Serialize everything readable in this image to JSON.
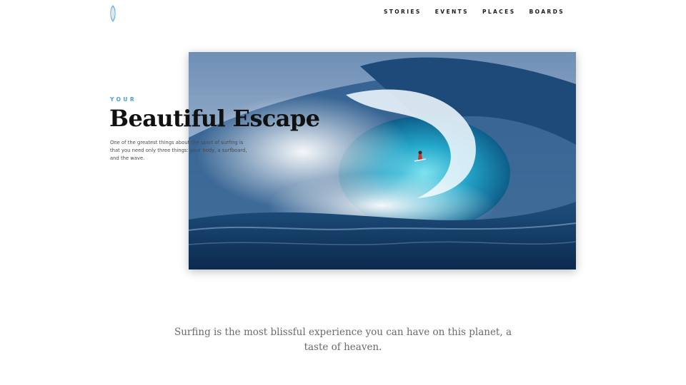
{
  "header": {
    "logo_icon": "surfboard-icon",
    "nav": [
      {
        "label": "STORIES"
      },
      {
        "label": "EVENTS"
      },
      {
        "label": "PLACES"
      },
      {
        "label": "BOARDS"
      }
    ]
  },
  "hero": {
    "eyebrow": "YOUR",
    "title": "Beautiful Escape",
    "description": "One of the greatest things about the sport of surfing is that you need only three things: your body, a surfboard, and the wave.",
    "image_icon": "surfer-wave-photo"
  },
  "quote": {
    "text": "Surfing is the most blissful experience you can have on this planet, a taste of heaven."
  },
  "colors": {
    "accent": "#4a9fe0",
    "heading": "#111111",
    "body_text": "#4a4a4a",
    "quote_text": "#6a6a6a"
  }
}
